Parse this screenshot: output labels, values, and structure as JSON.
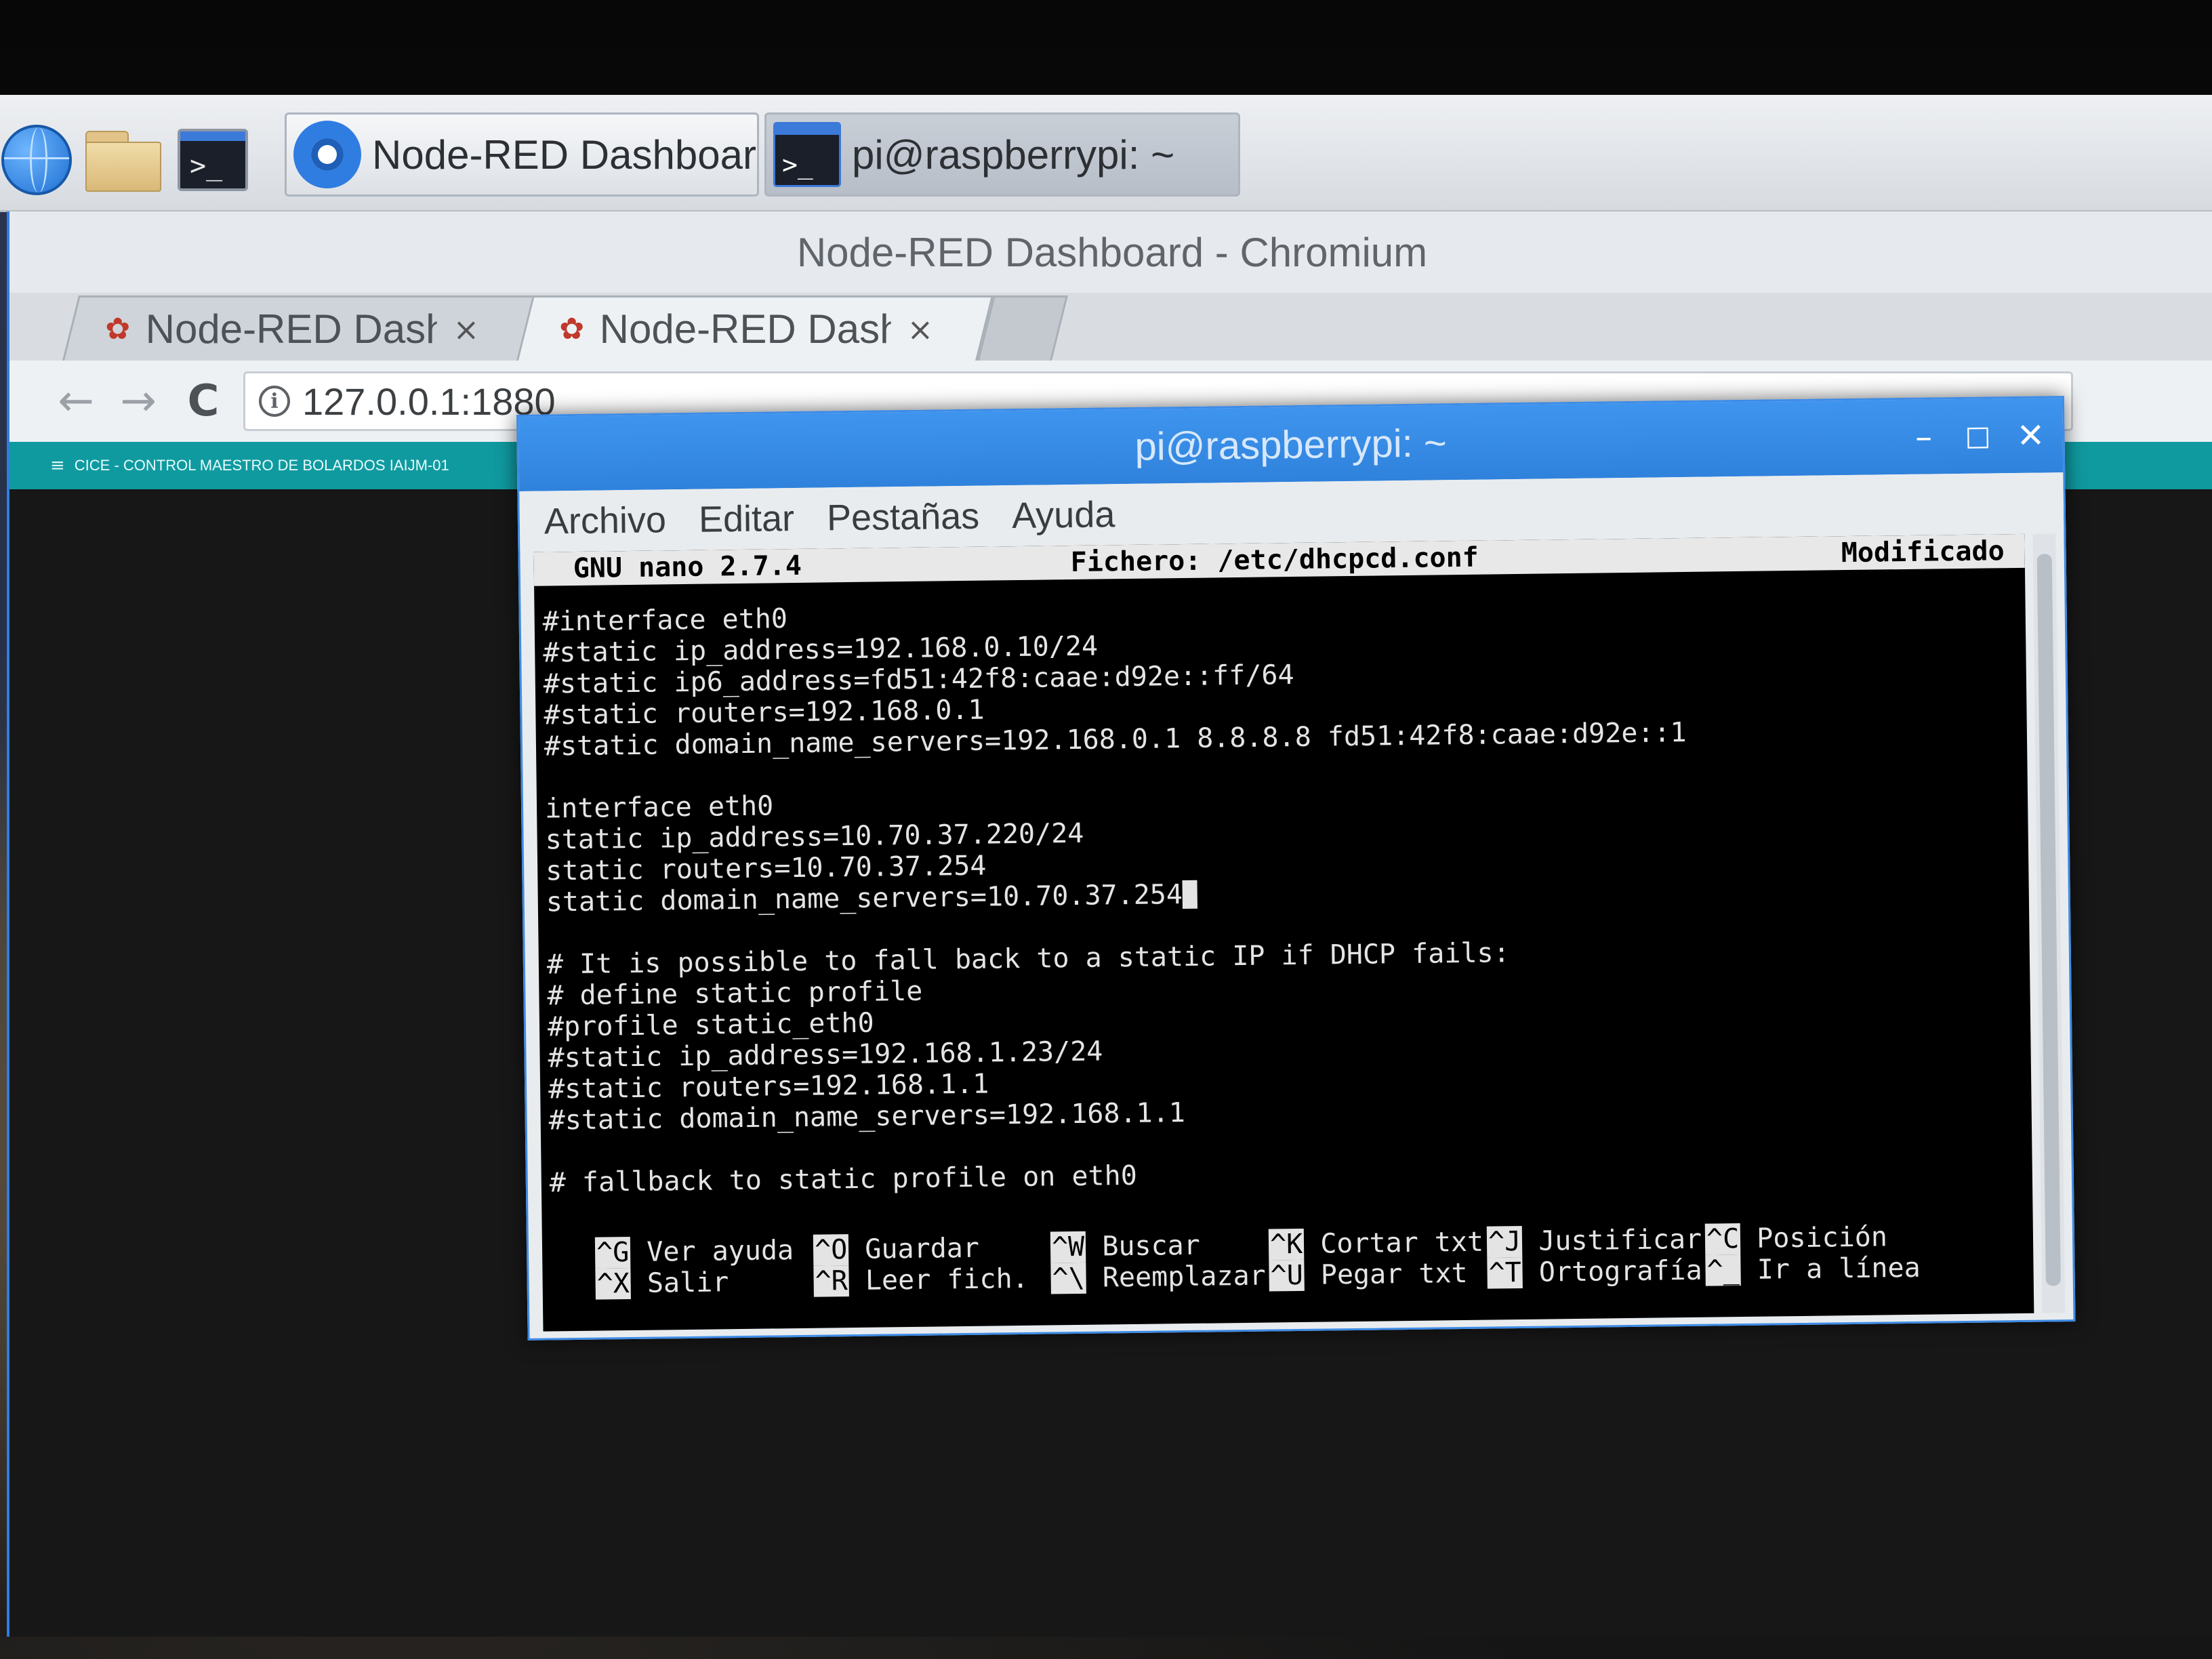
{
  "taskbar": {
    "launchers": [
      {
        "icon": "globe-icon"
      },
      {
        "icon": "folder-icon"
      },
      {
        "icon": "terminal-icon",
        "glyph": ">_"
      }
    ],
    "tasks": [
      {
        "label": "Node-RED Dashboar...",
        "icon": "chromium-icon"
      },
      {
        "label": "pi@raspberrypi: ~",
        "icon": "terminal-icon",
        "glyph": ">_",
        "active": true
      }
    ]
  },
  "browser": {
    "window_title": "Node-RED Dashboard - Chromium",
    "tabs": [
      {
        "label": "Node-RED Dashbo",
        "close": "×"
      },
      {
        "label": "Node-RED Dashbo",
        "close": "×",
        "active": true
      }
    ],
    "nav": {
      "back": "←",
      "forward": "→",
      "reload": "C"
    },
    "address": "127.0.0.1:1880",
    "info_glyph": "i",
    "dashboard": {
      "menu_glyph": "≡",
      "title": "CICE - CONTROL MAESTRO DE BOLARDOS IAIJM-01"
    }
  },
  "terminal": {
    "title": "pi@raspberrypi: ~",
    "controls": {
      "minimize": "–",
      "maximize": "□",
      "close": "✕"
    },
    "menu": [
      "Archivo",
      "Editar",
      "Pestañas",
      "Ayuda"
    ],
    "nano": {
      "version": "GNU nano 2.7.4",
      "file": "Fichero: /etc/dhcpcd.conf",
      "status": "Modificado",
      "lines": [
        "#interface eth0",
        "#static ip_address=192.168.0.10/24",
        "#static ip6_address=fd51:42f8:caae:d92e::ff/64",
        "#static routers=192.168.0.1",
        "#static domain_name_servers=192.168.0.1 8.8.8.8 fd51:42f8:caae:d92e::1",
        "",
        "interface eth0",
        "static ip_address=10.70.37.220/24",
        "static routers=10.70.37.254",
        "static domain_name_servers=10.70.37.254",
        "",
        "# It is possible to fall back to a static IP if DHCP fails:",
        "# define static profile",
        "#profile static_eth0",
        "#static ip_address=192.168.1.23/24",
        "#static routers=192.168.1.1",
        "#static domain_name_servers=192.168.1.1",
        "",
        "# fallback to static profile on eth0"
      ],
      "shortcuts_row1": [
        {
          "key": "^G",
          "label": "Ver ayuda"
        },
        {
          "key": "^O",
          "label": "Guardar"
        },
        {
          "key": "^W",
          "label": "Buscar"
        },
        {
          "key": "^K",
          "label": "Cortar txt"
        },
        {
          "key": "^J",
          "label": "Justificar"
        },
        {
          "key": "^C",
          "label": "Posición"
        }
      ],
      "shortcuts_row2": [
        {
          "key": "^X",
          "label": "Salir"
        },
        {
          "key": "^R",
          "label": "Leer fich."
        },
        {
          "key": "^\\",
          "label": "Reemplazar"
        },
        {
          "key": "^U",
          "label": "Pegar txt"
        },
        {
          "key": "^T",
          "label": "Ortografía"
        },
        {
          "key": "^_",
          "label": "Ir a línea"
        }
      ]
    }
  }
}
